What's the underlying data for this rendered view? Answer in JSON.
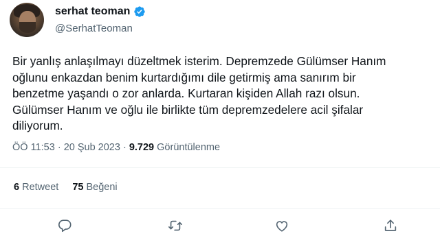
{
  "author": {
    "display_name": "serhat teoman",
    "handle": "@SerhatTeoman"
  },
  "tweet": {
    "text": "Bir yanlış anlaşılmayı düzeltmek isterim. Depremzede Gülümser Hanım\noğlunu enkazdan benim kurtardığımı dile getirmiş ama sanırım bir\nbenzetme yaşandı o zor anlarda. Kurtaran kişiden Allah razı olsun.\nGülümser Hanım ve oğlu ile birlikte tüm depremzedelere acil şifalar\ndiliyorum."
  },
  "meta": {
    "time": "ÖÖ 11:53",
    "separator1": " · ",
    "date": "20 Şub 2023",
    "separator2": " · ",
    "views_count": "9.729",
    "views_label": " Görüntülenme"
  },
  "stats": {
    "retweet_count": "6",
    "retweet_label": "Retweet",
    "like_count": "75",
    "like_label": "Beğeni"
  },
  "colors": {
    "text": "#0f1419",
    "secondary": "#536471",
    "verified": "#1d9bf0",
    "divider": "#eff3f4"
  },
  "icons": {
    "verified": "verified-badge-icon",
    "reply": "reply-icon",
    "retweet": "retweet-icon",
    "like": "heart-icon",
    "share": "share-icon"
  }
}
